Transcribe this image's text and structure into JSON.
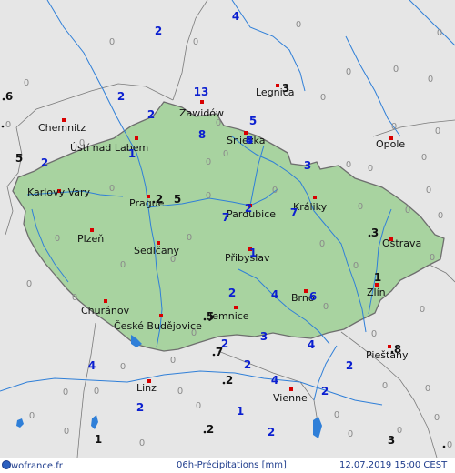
{
  "colors": {
    "background": "#e6e6e6",
    "country_fill": "#a8d3a0",
    "country_border": "#6e6e6e",
    "river": "#2f7fd8",
    "lake": "#2f7fd8",
    "city_marker": "#d80000",
    "blue_value": "#0b1fd0",
    "grey_value": "#8a8a8a",
    "black_value": "#111111",
    "footer_text": "#1e3c8c"
  },
  "cities": [
    "Chemnitz",
    "Ústí nad Labem",
    "Legnica",
    "Zawidów",
    "Sniezka",
    "Opole",
    "Karlovy Vary",
    "Prague",
    "Pardubice",
    "Králiky",
    "Ostrava",
    "Plzeň",
    "Sedlčany",
    "Přibyslav",
    "Churánov",
    "České Budějovice",
    "Jemnice",
    "Brno",
    "Zlín",
    "Piešťany",
    "Linz",
    "Vienne"
  ],
  "precip_values": [
    {
      "v": "4",
      "c": "blue"
    },
    {
      "v": "2",
      "c": "blue"
    },
    {
      "v": "0",
      "c": "grey"
    },
    {
      "v": "0",
      "c": "grey"
    },
    {
      "v": "0",
      "c": "grey"
    },
    {
      "v": "0",
      "c": "grey"
    },
    {
      "v": "0",
      "c": "grey"
    },
    {
      "v": "0",
      "c": "grey"
    },
    {
      "v": "0",
      "c": "grey"
    },
    {
      "v": "3",
      "c": "black"
    },
    {
      "v": "0",
      "c": "grey"
    },
    {
      "v": "0",
      "c": "grey"
    },
    {
      "v": "6",
      "c": "black"
    },
    {
      "v": "2",
      "c": "blue"
    },
    {
      "v": "2",
      "c": "blue"
    },
    {
      "v": "13",
      "c": "blue"
    },
    {
      "v": "0",
      "c": "grey"
    },
    {
      "v": "0",
      "c": "grey"
    },
    {
      "v": "0",
      "c": "grey"
    },
    {
      "v": "8",
      "c": "blue"
    },
    {
      "v": "5",
      "c": "blue"
    },
    {
      "v": "0",
      "c": "grey"
    },
    {
      "v": "0",
      "c": "grey"
    },
    {
      "v": "4",
      "c": "blue"
    },
    {
      "v": "0",
      "c": "grey"
    },
    {
      "v": "8",
      "c": "blue"
    },
    {
      "v": "1",
      "c": "blue"
    },
    {
      "v": "0",
      "c": "grey"
    },
    {
      "v": "5",
      "c": "black"
    },
    {
      "v": "2",
      "c": "blue"
    },
    {
      "v": "0",
      "c": "grey"
    },
    {
      "v": "0",
      "c": "grey"
    },
    {
      "v": "0",
      "c": "grey"
    },
    {
      "v": "3",
      "c": "blue"
    },
    {
      "v": "0",
      "c": "grey"
    },
    {
      "v": "0",
      "c": "grey"
    },
    {
      "v": "2",
      "c": "black"
    },
    {
      "v": "5",
      "c": "black"
    },
    {
      "v": "0",
      "c": "grey"
    },
    {
      "v": "0",
      "c": "grey"
    },
    {
      "v": "2",
      "c": "blue"
    },
    {
      "v": "7",
      "c": "blue"
    },
    {
      "v": "7",
      "c": "blue"
    },
    {
      "v": "0",
      "c": "grey"
    },
    {
      "v": "0",
      "c": "grey"
    },
    {
      "v": "0",
      "c": "grey"
    },
    {
      "v": "3",
      "c": "black"
    },
    {
      "v": "0",
      "c": "grey"
    },
    {
      "v": "0",
      "c": "grey"
    },
    {
      "v": "0",
      "c": "grey"
    },
    {
      "v": "0",
      "c": "grey"
    },
    {
      "v": "0",
      "c": "grey"
    },
    {
      "v": "0",
      "c": "grey"
    },
    {
      "v": "0",
      "c": "grey"
    },
    {
      "v": "1",
      "c": "blue"
    },
    {
      "v": "0",
      "c": "grey"
    },
    {
      "v": "2",
      "c": "blue"
    },
    {
      "v": "4",
      "c": "blue"
    },
    {
      "v": "6",
      "c": "blue"
    },
    {
      "v": "1",
      "c": "black"
    },
    {
      "v": "0",
      "c": "grey"
    },
    {
      "v": "0",
      "c": "grey"
    },
    {
      "v": "0",
      "c": "grey"
    },
    {
      "v": "5",
      "c": "black"
    },
    {
      "v": "3",
      "c": "blue"
    },
    {
      "v": "0",
      "c": "grey"
    },
    {
      "v": "0",
      "c": "grey"
    },
    {
      "v": "4",
      "c": "blue"
    },
    {
      "v": "2",
      "c": "blue"
    },
    {
      "v": "7",
      "c": "black"
    },
    {
      "v": "8",
      "c": "black"
    },
    {
      "v": "4",
      "c": "blue"
    },
    {
      "v": "0",
      "c": "grey"
    },
    {
      "v": "0",
      "c": "grey"
    },
    {
      "v": "2",
      "c": "blue"
    },
    {
      "v": "4",
      "c": "blue"
    },
    {
      "v": "2",
      "c": "blue"
    },
    {
      "v": "2",
      "c": "black"
    },
    {
      "v": "2",
      "c": "blue"
    },
    {
      "v": "0",
      "c": "grey"
    },
    {
      "v": "0",
      "c": "grey"
    },
    {
      "v": "0",
      "c": "grey"
    },
    {
      "v": "0",
      "c": "grey"
    },
    {
      "v": "0",
      "c": "grey"
    },
    {
      "v": "2",
      "c": "blue"
    },
    {
      "v": "0",
      "c": "grey"
    },
    {
      "v": "0",
      "c": "grey"
    },
    {
      "v": "0",
      "c": "grey"
    },
    {
      "v": "1",
      "c": "blue"
    },
    {
      "v": "0",
      "c": "grey"
    },
    {
      "v": "2",
      "c": "black"
    },
    {
      "v": "0",
      "c": "grey"
    },
    {
      "v": "0",
      "c": "grey"
    },
    {
      "v": "0",
      "c": "grey"
    },
    {
      "v": "2",
      "c": "blue"
    },
    {
      "v": "1",
      "c": "black"
    },
    {
      "v": "0",
      "c": "grey"
    },
    {
      "v": "0",
      "c": "grey"
    },
    {
      "v": "3",
      "c": "black"
    }
  ],
  "footer": {
    "brand": "wofrance.fr",
    "caption": "06h-Précipitations [mm]",
    "datetime": "12.07.2019 15:00 CEST"
  }
}
